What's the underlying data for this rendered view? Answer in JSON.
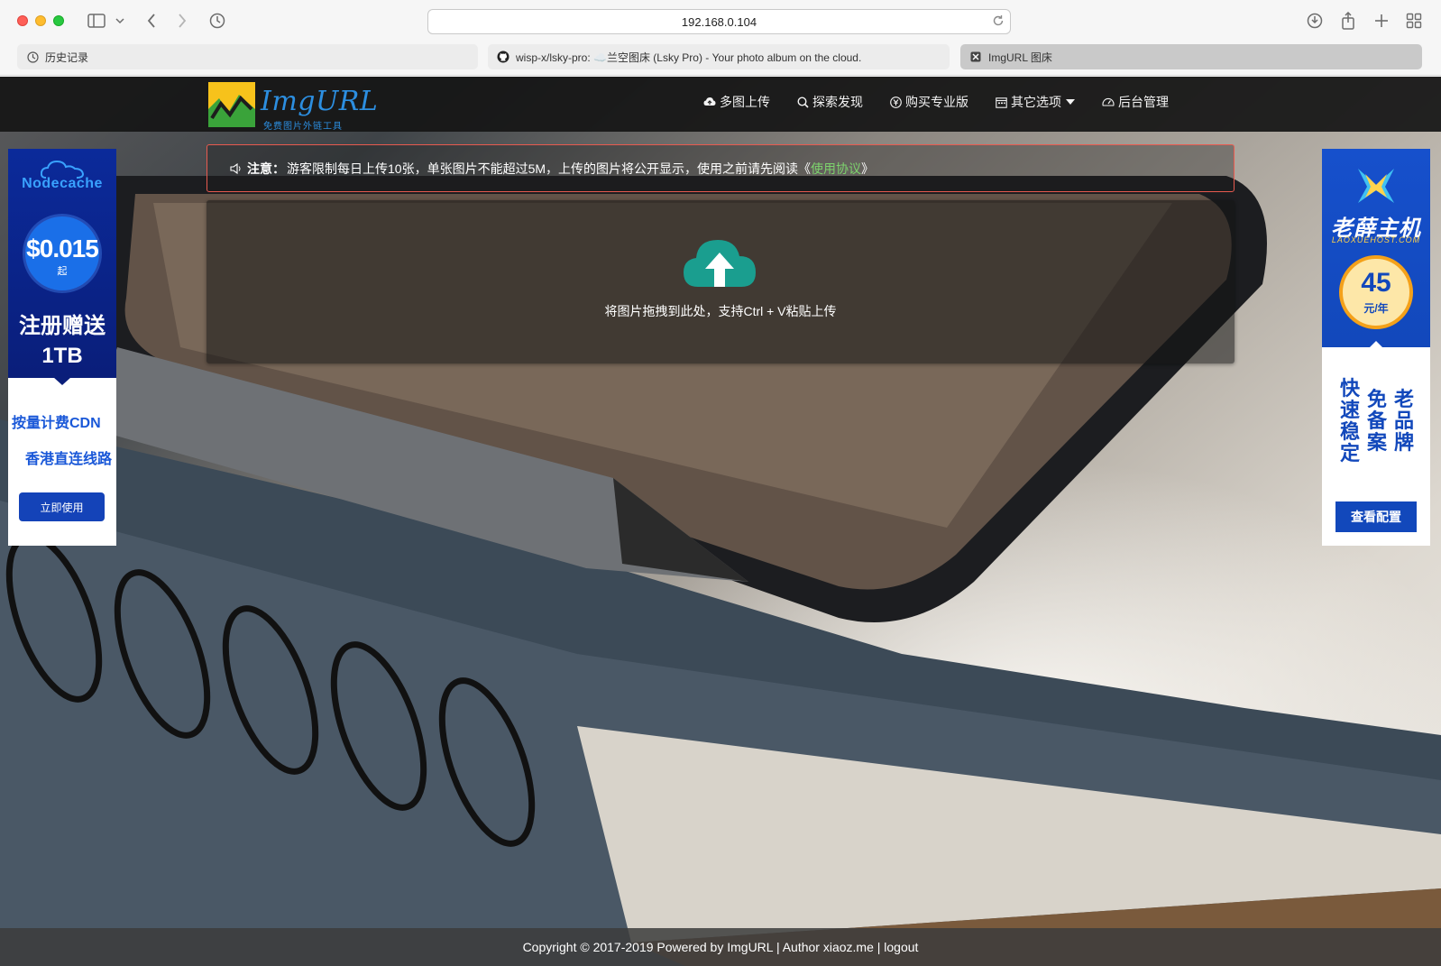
{
  "browser": {
    "url": "192.168.0.104",
    "tabs": [
      {
        "label": "历史记录",
        "icon": "clock-icon"
      },
      {
        "label": "wisp-x/lsky-pro: ☁️兰空图床 (Lsky Pro) - Your photo album on the cloud.",
        "icon": "github-icon"
      },
      {
        "label": "ImgURL 图床",
        "icon": "favicon-icon"
      }
    ]
  },
  "site": {
    "logo_text": "ImgURL",
    "logo_sub": "免费图片外链工具",
    "nav": [
      {
        "label": "多图上传",
        "icon": "cloud-upload-icon"
      },
      {
        "label": "探索发现",
        "icon": "search-icon"
      },
      {
        "label": "购买专业版",
        "icon": "yen-icon"
      },
      {
        "label": "其它选项",
        "icon": "calendar-icon"
      },
      {
        "label": "后台管理",
        "icon": "dashboard-icon"
      }
    ],
    "notice": {
      "label": "注意：",
      "text": "游客限制每日上传10张，单张图片不能超过5M，上传的图片将公开显示，使用之前请先阅读",
      "open": "《",
      "link": "使用协议",
      "close": "》"
    },
    "upload": {
      "hint": "将图片拖拽到此处，支持Ctrl + V粘贴上传",
      "icon_color": "#1a9e8f"
    },
    "footer": "Copyright © 2017-2019 Powered by ImgURL | Author xiaoz.me | logout"
  },
  "ads": {
    "left": {
      "brand": "Nodecache",
      "price": "$0.015",
      "price_unit": "起",
      "headline_1": "注册赠送",
      "headline_2": "1TB",
      "line_1": "按量计费CDN",
      "line_2": "香港直连线路",
      "button": "立即使用"
    },
    "right": {
      "brand": "老薛主机",
      "brand_en": "LAOXUEHOST.COM",
      "price": "45",
      "price_unit": "元/年",
      "col_1": "快速稳定",
      "col_2": "免备案",
      "col_3": "老品牌",
      "button": "查看配置"
    }
  },
  "colors": {
    "accent": "#2c8ee0",
    "notice_border": "#e85a4f",
    "link": "#7dd36d",
    "upload_icon": "#1a9e8f"
  }
}
